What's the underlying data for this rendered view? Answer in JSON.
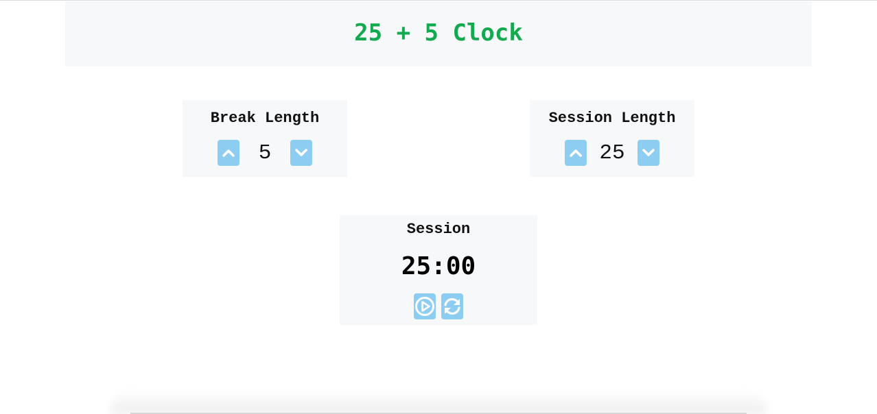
{
  "header": {
    "title": "25 + 5 Clock"
  },
  "break_control": {
    "label": "Break Length",
    "value": "5",
    "increment_icon": "chevron-up-icon",
    "decrement_icon": "chevron-down-icon"
  },
  "session_control": {
    "label": "Session Length",
    "value": "25",
    "increment_icon": "chevron-up-icon",
    "decrement_icon": "chevron-down-icon"
  },
  "timer": {
    "label": "Session",
    "time_left": "25:00",
    "start_stop_icon": "play-circle-icon",
    "reset_icon": "refresh-icon"
  },
  "colors": {
    "title": "#13a94f",
    "button": "#8ecdf2",
    "panel_background": "#f7f8fa"
  }
}
